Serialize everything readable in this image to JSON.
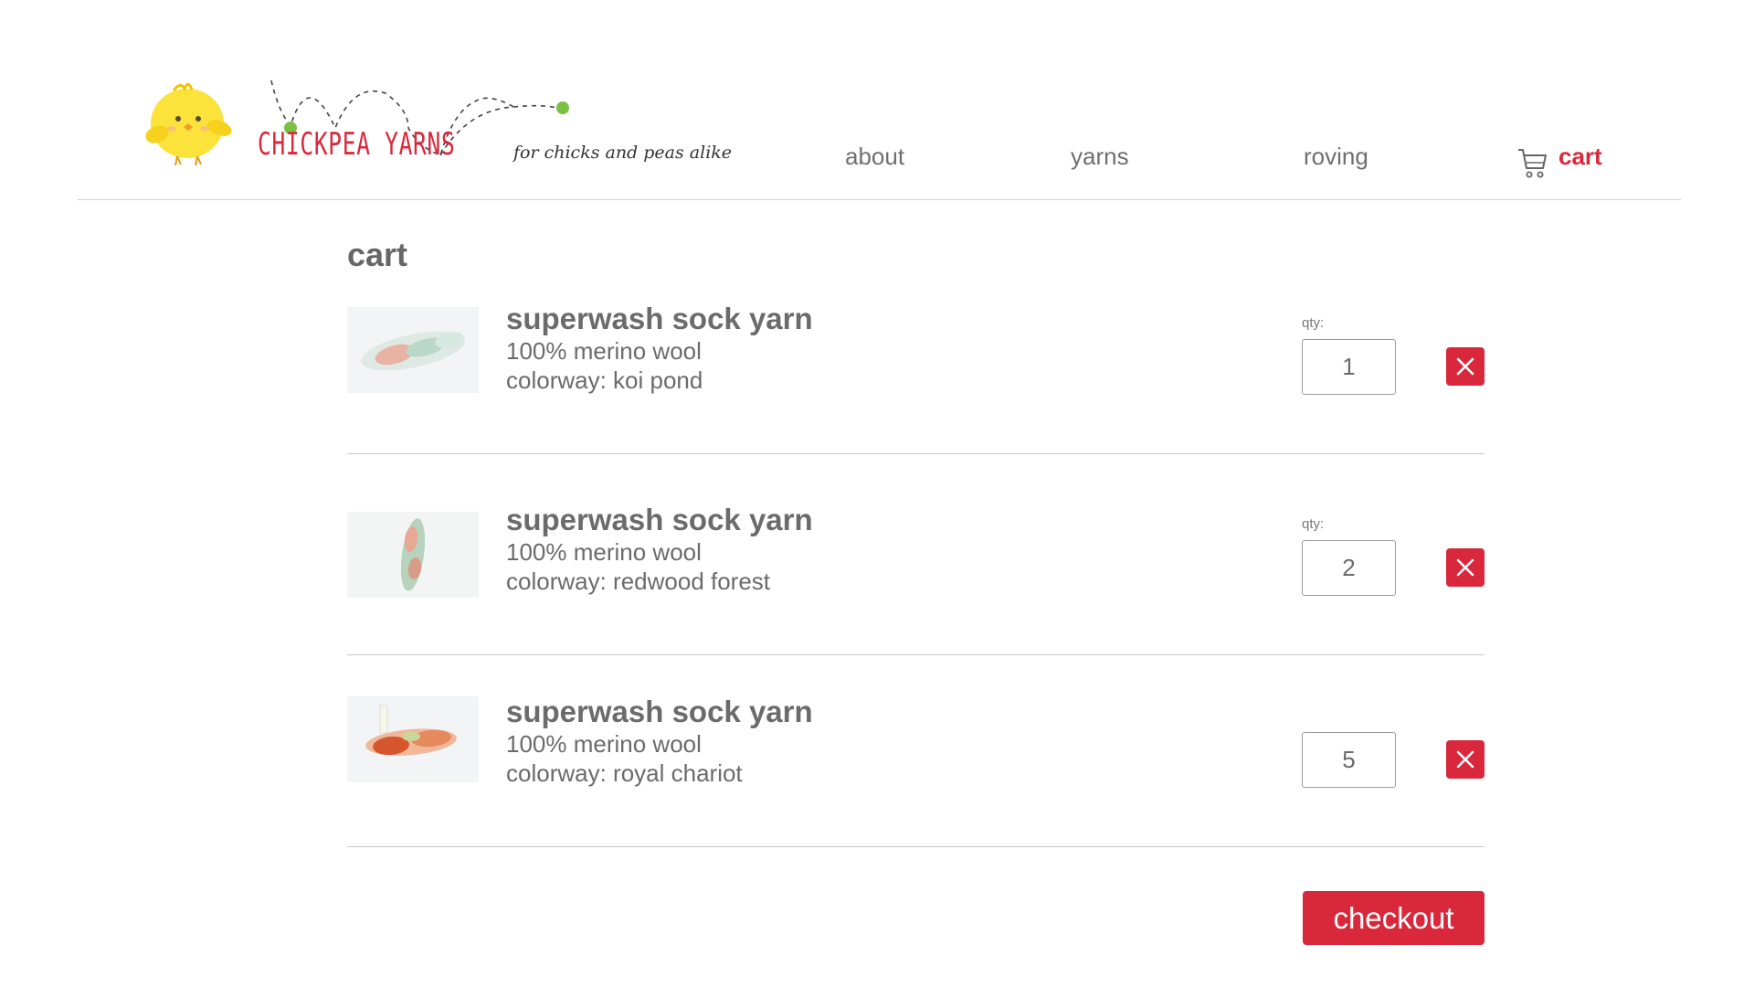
{
  "brand": {
    "name": "CHICKPEA YARNS",
    "tagline": "for chicks and peas alike"
  },
  "nav": {
    "items": [
      {
        "label": "about"
      },
      {
        "label": "yarns"
      },
      {
        "label": "roving"
      },
      {
        "label": "cart"
      }
    ],
    "active": "cart"
  },
  "page": {
    "title": "cart"
  },
  "cart": {
    "qty_label": "qty:",
    "items": [
      {
        "name": "superwash sock yarn",
        "fiber": "100% merino wool",
        "colorway": "colorway: koi pond",
        "qty": "1",
        "show_qty_label": true
      },
      {
        "name": "superwash sock yarn",
        "fiber": "100% merino wool",
        "colorway": "colorway: redwood forest",
        "qty": "2",
        "show_qty_label": true
      },
      {
        "name": "superwash sock yarn",
        "fiber": "100% merino wool",
        "colorway": "colorway: royal chariot",
        "qty": "5",
        "show_qty_label": false
      }
    ],
    "checkout_label": "checkout"
  },
  "colors": {
    "accent": "#d9283b",
    "text": "#666666",
    "rule": "#c8c8c8",
    "chick": "#fce33b",
    "pea": "#7ac143"
  }
}
